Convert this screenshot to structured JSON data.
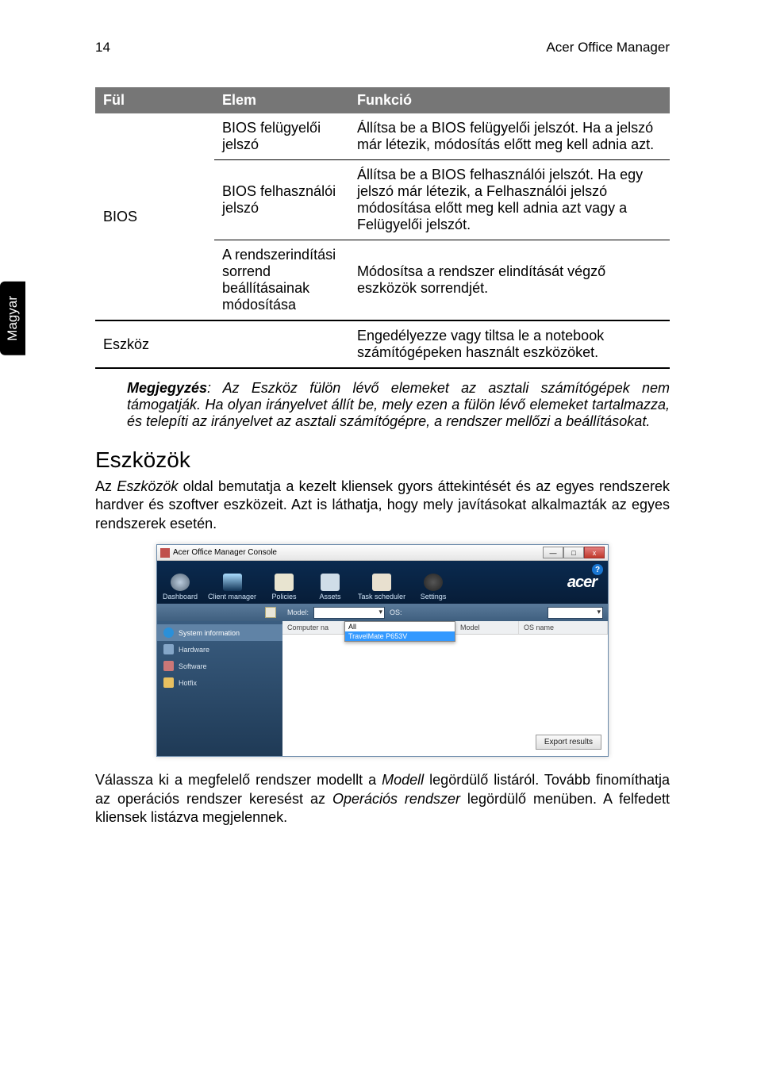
{
  "page_number": "14",
  "doc_title": "Acer Office Manager",
  "side_tab": "Magyar",
  "table": {
    "headers": {
      "c1": "Fül",
      "c2": "Elem",
      "c3": "Funkció"
    },
    "bios_label": "BIOS",
    "rows": [
      {
        "elem": "BIOS felügyelői jelszó",
        "funk": "Állítsa be a BIOS felügyelői jelszót. Ha a jelszó már létezik, módosítás előtt meg kell adnia azt."
      },
      {
        "elem": "BIOS felhasználói jelszó",
        "funk": "Állítsa be a BIOS felhasználói jelszót. Ha egy jelszó már létezik, a Felhasználói jelszó módosítása előtt meg kell adnia azt vagy a Felügyelői jelszót."
      },
      {
        "elem": "A rendszerindítási sorrend beállításainak módosítása",
        "funk": "Módosítsa a rendszer elindítását végző eszközök sorrendjét."
      }
    ],
    "eszkoz_label": "Eszköz",
    "eszkoz_funk": "Engedélyezze vagy tiltsa le a notebook számítógépeken használt eszközöket."
  },
  "note_label": "Megjegyzés",
  "note_text": ": Az Eszköz fülön lévő elemeket az asztali számítógépek nem támogatják. Ha olyan irányelvet állít be, mely ezen a fülön lévő elemeket tartalmazza, és telepíti az irányelvet az asztali számítógépre, a rendszer mellőzi a beállításokat.",
  "section_heading": "Eszközök",
  "para1_a": "Az ",
  "para1_em": "Eszközök",
  "para1_b": " oldal bemutatja a kezelt kliensek gyors áttekintését és az egyes rendszerek hardver és szoftver eszközeit. Azt is láthatja, hogy mely javításokat alkalmazták az egyes rendszerek esetén.",
  "para2_a": "Válassza ki a megfelelő rendszer modellt a ",
  "para2_em1": "Modell",
  "para2_b": " legördülő listáról. Tovább finomíthatja az operációs rendszer keresést az ",
  "para2_em2": "Operációs rendszer",
  "para2_c": " legördülő menüben. A felfedett kliensek listázva megjelennek.",
  "app": {
    "title": "Acer Office Manager Console",
    "tabs": [
      "Dashboard",
      "Client manager",
      "Policies",
      "Assets",
      "Task scheduler",
      "Settings"
    ],
    "logo": "acer",
    "help": "?",
    "filter": {
      "model_label": "Model:",
      "model_value": "",
      "os_label": "OS:",
      "os_value": ""
    },
    "sidebar": [
      "System information",
      "Hardware",
      "Software",
      "Hotfix"
    ],
    "cols": {
      "c1": "Computer na",
      "c2": "",
      "c3": "Model",
      "c4": "OS name"
    },
    "dropdown": {
      "opt1": "All",
      "opt2": "TravelMate P653V"
    },
    "export": "Export results",
    "winbtns": {
      "min": "—",
      "max": "□",
      "close": "x"
    }
  }
}
